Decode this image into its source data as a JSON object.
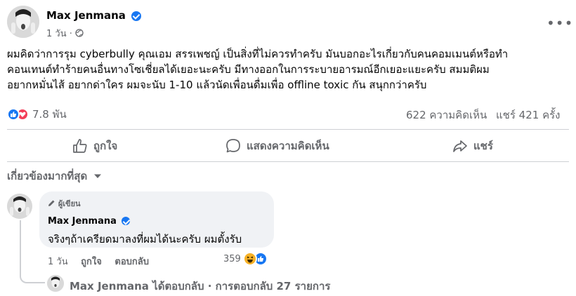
{
  "post": {
    "author": "Max Jenmana",
    "time": "1 วัน ·",
    "text_lines": [
      "ผมคิดว่าการรุม cyberbully คุณเอม สรรเพชญ์ เป็นสิ่งที่ไม่ควรทำครับ มันบอกอะไรเกี่ยวกับคนคอมเมนต์หรือทำ",
      "คอนเทนต์ทำร้ายคนอื่นทางโซเชี่ยลได้เยอะนะครับ มีทางออกในการระบายอารมณ์อีกเยอะแยะครับ สมมติผม",
      "อยากหมั่นไส้ อยากด่าใคร ผมจะนับ 1-10 แล้วนัดเพื่อนดื่มเพื่อ offline toxic กัน สนุกกว่าครับ"
    ],
    "reactions_count": "7.8 พัน",
    "comments_count": "622 ความคิดเห็น",
    "shares_count": "แชร์ 421 ครั้ง"
  },
  "actions": {
    "like": "ถูกใจ",
    "comment": "แสดงความคิดเห็น",
    "share": "แชร์"
  },
  "sort": {
    "label": "เกี่ยวข้องมากที่สุด"
  },
  "comment": {
    "author_tag": "ผู้เขียน",
    "author": "Max Jenmana",
    "text": "จริงๆถ้าเครียดมาลงที่ผมได้นะครับ ผมตั้งรับ",
    "time": "1 วัน",
    "like": "ถูกใจ",
    "reply": "ตอบกลับ",
    "reaction_count": "359"
  },
  "replies": {
    "summary": "Max Jenmana ได้ตอบกลับ · การตอบกลับ 27 รายการ"
  },
  "colors": {
    "accent": "#1877f2",
    "secondary_text": "#65676b",
    "love": "#f33e58",
    "haha": "#f7b125"
  },
  "icons": [
    "globe-icon",
    "more-icon",
    "like-reaction-icon",
    "love-reaction-icon",
    "haha-reaction-icon",
    "thumbs-up-icon",
    "comment-icon",
    "share-icon",
    "caret-down-icon",
    "pencil-icon",
    "verified-icon"
  ]
}
